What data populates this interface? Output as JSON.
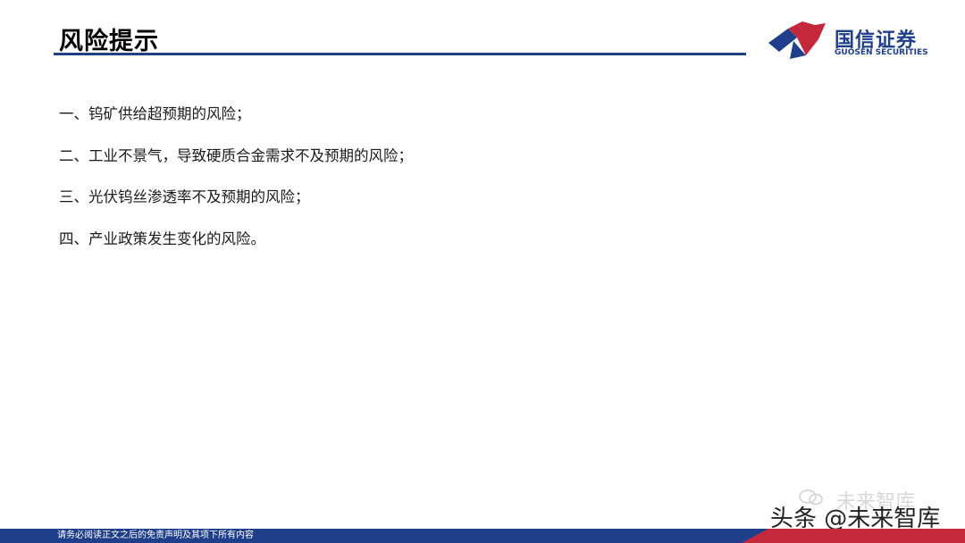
{
  "header": {
    "title": "风险提示",
    "logo_cn": "国信证券",
    "logo_en": "GUOSEN SECURITIES"
  },
  "risks": [
    "一、钨矿供给超预期的风险；",
    "二、工业不景气，导致硬质合金需求不及预期的风险；",
    "三、光伏钨丝渗透率不及预期的风险；",
    "四、产业政策发生变化的风险。"
  ],
  "watermark": {
    "faded": "未来智库",
    "main": "头条 @未来智库"
  },
  "footer": {
    "disclaimer": "请务必阅读正文之后的免责声明及其项下所有内容"
  },
  "colors": {
    "brand_blue": "#1f3f8a",
    "brand_red": "#c4283c"
  }
}
